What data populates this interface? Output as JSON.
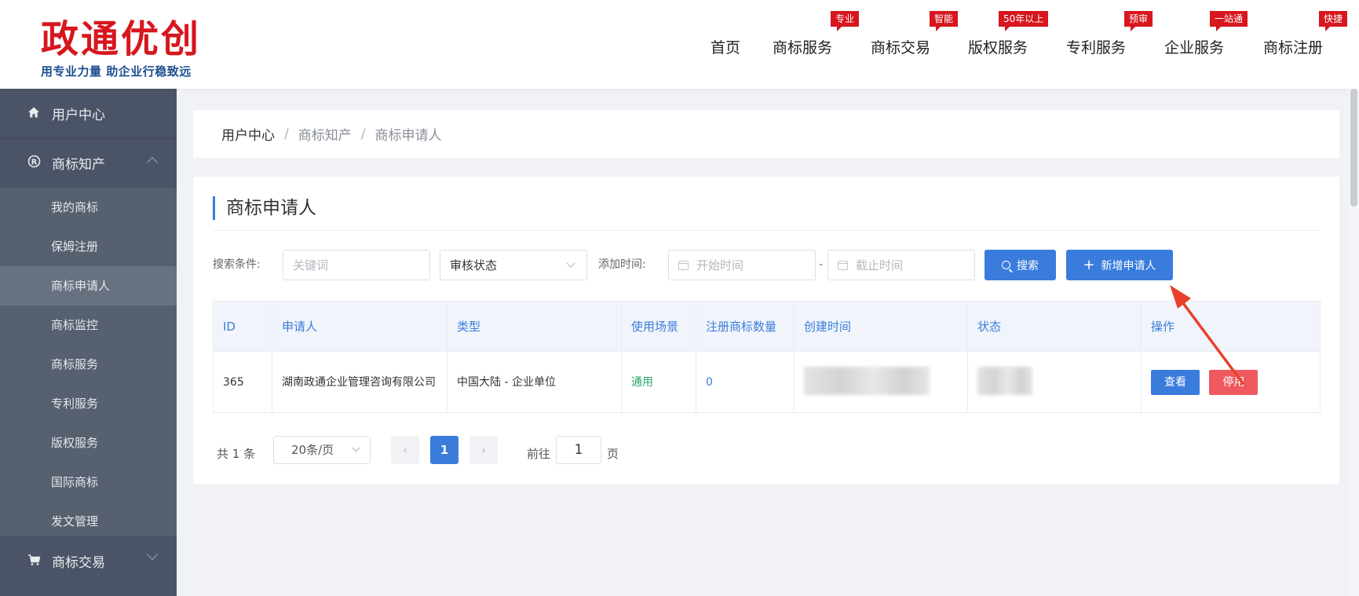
{
  "header": {
    "logo": {
      "part1": "政通",
      "part2": "优创",
      "slogan": "用专业力量  助企业行稳致远"
    },
    "nav": [
      {
        "label": "首页",
        "badge": ""
      },
      {
        "label": "商标服务",
        "badge": "专业"
      },
      {
        "label": "商标交易",
        "badge": "智能"
      },
      {
        "label": "版权服务",
        "badge": "50年以上"
      },
      {
        "label": "专利服务",
        "badge": "预审"
      },
      {
        "label": "企业服务",
        "badge": "一站通"
      },
      {
        "label": "商标注册",
        "badge": "快捷"
      }
    ]
  },
  "sidebar": {
    "user_center": {
      "label": "用户中心",
      "icon": "home-icon"
    },
    "trademark_ip": {
      "label": "商标知产",
      "icon": "registered-icon"
    },
    "sub_items": [
      {
        "label": "我的商标"
      },
      {
        "label": "保姆注册"
      },
      {
        "label": "商标申请人"
      },
      {
        "label": "商标监控"
      },
      {
        "label": "商标服务"
      },
      {
        "label": "专利服务"
      },
      {
        "label": "版权服务"
      },
      {
        "label": "国际商标"
      },
      {
        "label": "发文管理"
      }
    ],
    "active_sub": "商标申请人",
    "trademark_trade": {
      "label": "商标交易",
      "icon": "cart-icon"
    }
  },
  "breadcrumb": {
    "items": [
      "用户中心",
      "商标知产",
      "商标申请人"
    ],
    "separator": "/"
  },
  "main": {
    "title": "商标申请人",
    "search": {
      "label": "搜索条件:",
      "keyword_placeholder": "关键词",
      "status_value": "审核状态",
      "time_label": "添加时间:",
      "start_placeholder": "开始时间",
      "end_placeholder": "截止时间",
      "range_separator": "-",
      "search_button": "搜索",
      "add_button": "新增申请人"
    },
    "table": {
      "columns": [
        "ID",
        "申请人",
        "类型",
        "使用场景",
        "注册商标数量",
        "创建时间",
        "状态",
        "操作"
      ],
      "rows": [
        {
          "id": "365",
          "applicant": "湖南政通企业管理咨询有限公司",
          "type": "中国大陆 - 企业单位",
          "scene": "通用",
          "count": "0",
          "view_label": "查看",
          "disable_label": "停用"
        }
      ]
    },
    "pagination": {
      "total_text": "共 1 条",
      "page_size": "20条/页",
      "prev": "‹",
      "current_page": "1",
      "next": "›",
      "goto_prefix": "前往",
      "goto_value": "1",
      "goto_suffix": "页"
    }
  },
  "colors": {
    "primary": "#3a7cdc",
    "danger": "#ee5a5f",
    "sidebar": "#4a5466",
    "brand_red": "#d7161e",
    "brand_blue": "#1d4f91",
    "success": "#2aa66b"
  }
}
